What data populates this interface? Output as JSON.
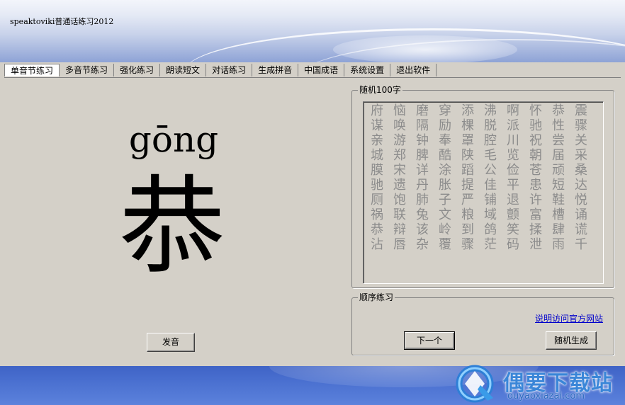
{
  "window": {
    "title": "speaktoviki普通话练习2012"
  },
  "tabs": [
    {
      "label": "单音节练习",
      "active": true
    },
    {
      "label": "多音节练习"
    },
    {
      "label": "强化练习"
    },
    {
      "label": "朗读短文"
    },
    {
      "label": "对话练习"
    },
    {
      "label": "生成拼音"
    },
    {
      "label": "中国成语"
    },
    {
      "label": "系统设置"
    },
    {
      "label": "退出软件"
    }
  ],
  "practice": {
    "pinyin": "gōng",
    "character": "恭",
    "pronounce_button": "发音"
  },
  "random_group": {
    "title": "随机100字",
    "rows": [
      [
        "府",
        "恼",
        "磨",
        "穿",
        "添",
        "沸",
        "啊",
        "怀",
        "恭",
        "震"
      ],
      [
        "谋",
        "唤",
        "隔",
        "励",
        "棵",
        "脱",
        "派",
        "驰",
        "性",
        "骤"
      ],
      [
        "亲",
        "游",
        "钟",
        "奉",
        "罩",
        "腔",
        "川",
        "祝",
        "尝",
        "关"
      ],
      [
        "城",
        "郑",
        "脾",
        "酷",
        "陕",
        "毛",
        "览",
        "朝",
        "届",
        "采"
      ],
      [
        "膜",
        "宋",
        "详",
        "涂",
        "蹈",
        "公",
        "俭",
        "苍",
        "顽",
        "桑"
      ],
      [
        "驰",
        "遗",
        "丹",
        "胀",
        "提",
        "佳",
        "平",
        "患",
        "短",
        "达"
      ],
      [
        "厕",
        "饱",
        "肺",
        "子",
        "严",
        "铺",
        "退",
        "许",
        "鞋",
        "悦"
      ],
      [
        "祸",
        "联",
        "兔",
        "文",
        "粮",
        "域",
        "颤",
        "富",
        "槽",
        "诵"
      ],
      [
        "恭",
        "辩",
        "该",
        "岭",
        "到",
        "鸽",
        "笑",
        "揉",
        "肆",
        "谎"
      ],
      [
        "沾",
        "唇",
        "杂",
        "覆",
        "骤",
        "茫",
        "码",
        "泄",
        "雨",
        "千"
      ]
    ]
  },
  "sequence_group": {
    "title": "顺序练习",
    "link": "说明访问官方网站",
    "next_button": "下一个",
    "random_button": "随机生成"
  },
  "watermark": {
    "text": "偶要下载站",
    "url": "ouyaoxiazai.com"
  },
  "colors": {
    "window_bg": "#d4d0c8",
    "grid_text": "#8c8c8c",
    "link": "#0000cc",
    "footer_blue": "#4a70d0"
  }
}
